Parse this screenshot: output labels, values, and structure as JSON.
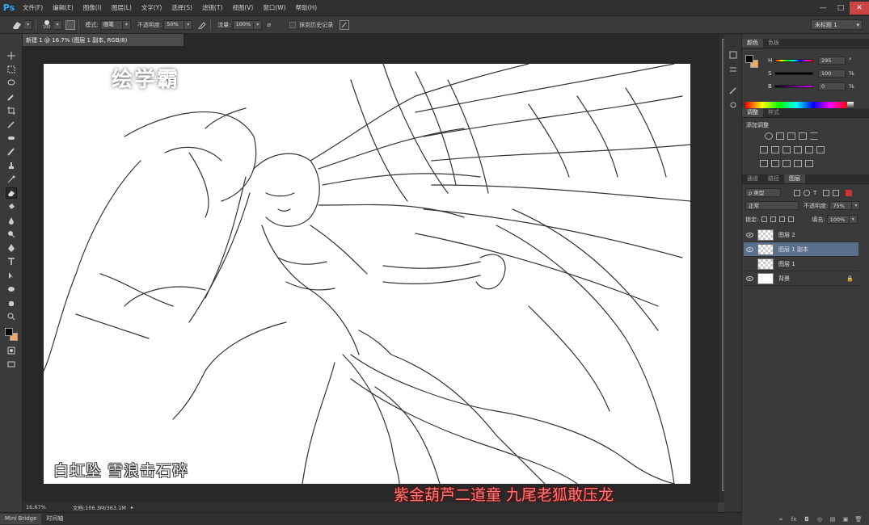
{
  "app": {
    "logo": "Ps"
  },
  "menu": [
    "文件(F)",
    "编辑(E)",
    "图像(I)",
    "图层(L)",
    "文字(Y)",
    "选择(S)",
    "滤镜(T)",
    "视图(V)",
    "窗口(W)",
    "帮助(H)"
  ],
  "window_controls": {
    "minimize": "—",
    "maximize": "□",
    "close": "✕"
  },
  "options": {
    "brush_size": "100",
    "mode_label": "模式:",
    "mode_value": "画笔",
    "opacity_label": "不透明度:",
    "opacity_value": "50%",
    "flow_label": "流量:",
    "flow_value": "100%",
    "erase_history_label": "抹到历史记录",
    "workspace": "未标题 1"
  },
  "document": {
    "tab_title": "新建 1 @ 16.7% (图层 1 副本, RGB/8)"
  },
  "watermark": {
    "brand": "绘学霸"
  },
  "captions": {
    "line1": "白虹坠 雪浪击石碎",
    "line2": "紫金葫芦二道童 九尾老狐敢压龙"
  },
  "status": {
    "zoom": "16.67%",
    "doc_info": "文档:106.3M/363.1M"
  },
  "bottom_tabs": [
    "Mini Bridge",
    "时间轴"
  ],
  "color_panel": {
    "tabs": [
      "颜色",
      "色板"
    ],
    "rows": [
      {
        "label": "H",
        "value": "295",
        "unit": "°"
      },
      {
        "label": "S",
        "value": "100",
        "unit": "%"
      },
      {
        "label": "B",
        "value": "0",
        "unit": "%"
      }
    ],
    "fg": "#000000",
    "bg": "#f0a868"
  },
  "adjust_panel": {
    "tabs": [
      "调整",
      "样式"
    ],
    "title": "添加调整"
  },
  "layers_panel": {
    "tabs": [
      "通道",
      "路径",
      "图层"
    ],
    "kind_filter": "ρ 类型",
    "blend_mode": "正常",
    "opacity_label": "不透明度:",
    "opacity_value": "75%",
    "lock_label": "锁定:",
    "fill_label": "填充:",
    "fill_value": "100%",
    "layers": [
      {
        "name": "图层 2",
        "visible": true,
        "selected": false,
        "white": false,
        "locked": false
      },
      {
        "name": "图层 1 副本",
        "visible": true,
        "selected": true,
        "white": false,
        "locked": false
      },
      {
        "name": "图层 1",
        "visible": false,
        "selected": false,
        "white": false,
        "locked": false
      },
      {
        "name": "背景",
        "visible": true,
        "selected": false,
        "white": true,
        "locked": true
      }
    ],
    "lock_glyph": "🔒",
    "footer_icons": [
      "∞",
      "fx",
      "◘",
      "◎",
      "▤",
      "▣",
      "🗑"
    ]
  }
}
